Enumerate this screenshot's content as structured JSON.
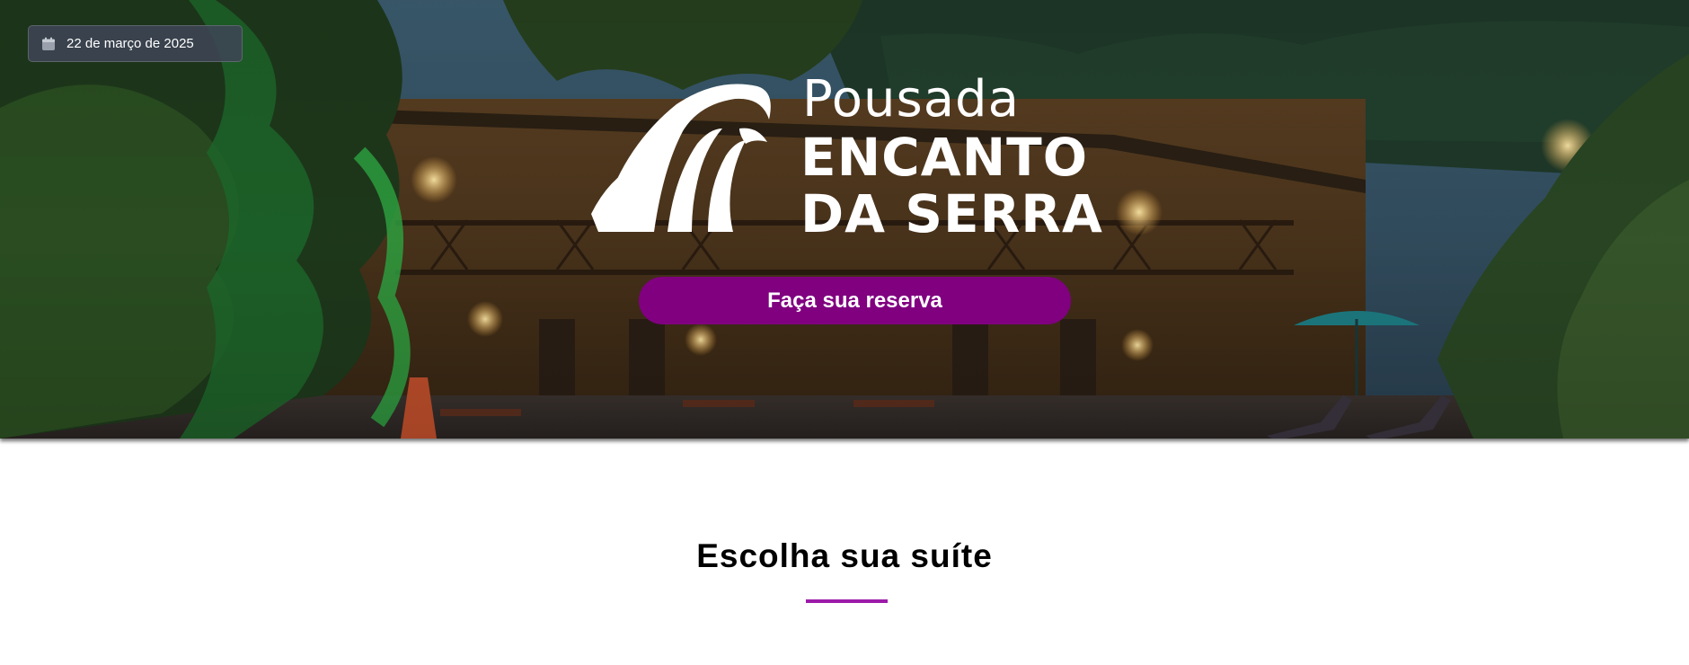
{
  "hero": {
    "date_text": "22 de março de 2025",
    "brand": {
      "line1": "Pousada",
      "line2": "ENCANTO",
      "line3": "DA SERRA"
    },
    "cta_label": "Faça sua reserva"
  },
  "suites": {
    "title": "Escolha sua suíte"
  },
  "icons": {
    "date": "calendar-icon",
    "logo": "wave-logo-icon"
  },
  "colors": {
    "cta": "#800080",
    "accent_underline": "#9c1aa8",
    "date_chip": "#3e4454"
  }
}
